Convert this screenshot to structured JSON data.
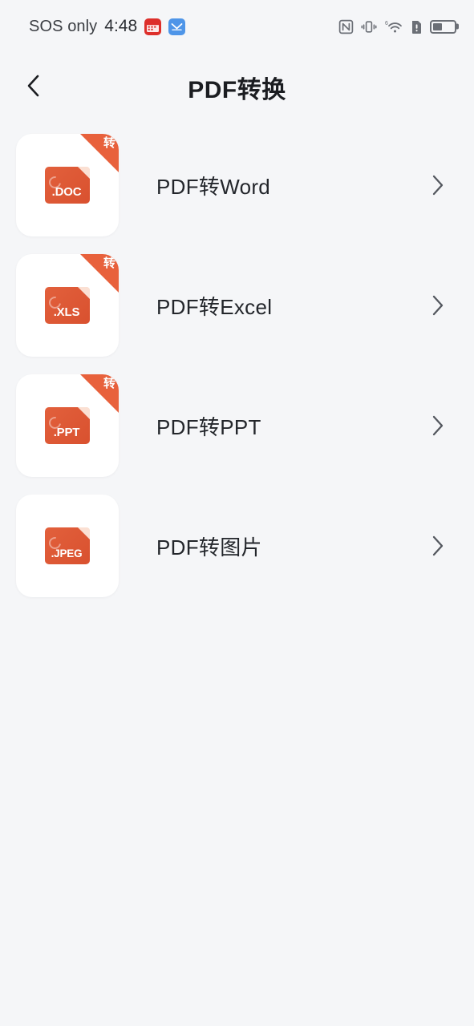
{
  "status_bar": {
    "carrier": "SOS only",
    "time": "4:48",
    "app_badges": [
      {
        "name": "calendar-app-badge",
        "color": "#dd2f2b"
      },
      {
        "name": "messenger-app-badge",
        "color": "#4e95e8"
      }
    ],
    "icons": [
      {
        "name": "nfc-icon"
      },
      {
        "name": "vibrate-icon"
      },
      {
        "name": "wifi-6-icon",
        "label": "6"
      },
      {
        "name": "sim-alert-icon"
      },
      {
        "name": "battery-icon",
        "level_percent": 45
      }
    ]
  },
  "header": {
    "back_icon": "chevron-left-icon",
    "title": "PDF转换"
  },
  "list": {
    "chevron_icon": "chevron-right-icon",
    "ribbon_char": "转",
    "items": [
      {
        "label": "PDF转Word",
        "file_ext": ".DOC",
        "icon_name": "pdf-to-word-icon",
        "has_ribbon": true
      },
      {
        "label": "PDF转Excel",
        "file_ext": ".XLS",
        "icon_name": "pdf-to-excel-icon",
        "has_ribbon": true
      },
      {
        "label": "PDF转PPT",
        "file_ext": ".PPT",
        "icon_name": "pdf-to-ppt-icon",
        "has_ribbon": true
      },
      {
        "label": "PDF转图片",
        "file_ext": ".JPEG",
        "icon_name": "pdf-to-image-icon",
        "has_ribbon": false
      }
    ]
  },
  "colors": {
    "background": "#f5f6f8",
    "card": "#ffffff",
    "accent_orange": "#e2603c",
    "ribbon_orange": "#e8613c",
    "text_primary": "#23262b",
    "text_status": "#3a3d42"
  }
}
